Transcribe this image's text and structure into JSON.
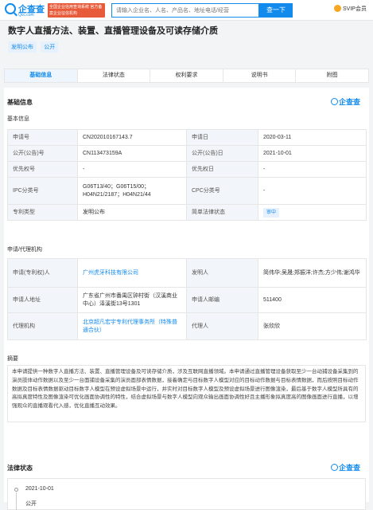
{
  "header": {
    "logo_text": "企查查",
    "logo_sub": "Qcc.com",
    "notice": "全国企业信用查询系统 官方备案企业征信机构",
    "search_placeholder": "请输入企业名、人名、产品名、地址电话/经营",
    "search_button": "查一下",
    "vip_label": "SVIP会员"
  },
  "patent": {
    "title": "数字人直播方法、装置、直播管理设备及可读存储介质",
    "tags": [
      "发明公布",
      "公开"
    ]
  },
  "tabs": [
    {
      "label": "基础信息",
      "active": true
    },
    {
      "label": "法律状态",
      "active": false
    },
    {
      "label": "权利要求",
      "active": false
    },
    {
      "label": "说明书",
      "active": false
    },
    {
      "label": "附图",
      "active": false
    }
  ],
  "basic": {
    "section_title": "基础信息",
    "brand": "企查查",
    "sub_title": "基本信息",
    "rows": [
      {
        "k1": "申请号",
        "v1": "CN202010167143.7",
        "k2": "申请日",
        "v2": "2020-03-11"
      },
      {
        "k1": "公开(公告)号",
        "v1": "CN113473159A",
        "k2": "公开(公告)日",
        "v2": "2021-10-01"
      },
      {
        "k1": "优先权号",
        "v1": "-",
        "k2": "优先权日",
        "v2": "-"
      },
      {
        "k1": "IPC分类号",
        "v1": "G06T13/40；G06T15/00；H04N21/2187；H04N21/44",
        "k2": "CPC分类号",
        "v2": "-"
      },
      {
        "k1": "专利类型",
        "v1": "发明公布",
        "k2": "简单法律状态",
        "v2": "审中"
      }
    ]
  },
  "applicant": {
    "sub_title": "申请/代理机构",
    "rows": [
      {
        "k1": "申请(专利权)人",
        "v1": "广州虎牙科技有限公司",
        "k2": "发明人",
        "v2": "简伟华;吴晟;郑振洋;许杰;方少伟;谢鸿华"
      },
      {
        "k1": "申请人地址",
        "v1": "广东省广州市番禺区钟村街（汉溪商业中心）泽溪街13号1301",
        "k2": "申请人邮编",
        "v2": "511400"
      },
      {
        "k1": "代理机构",
        "v1": "北京超凡宏宇专利代理事务所（特殊普通合伙）",
        "k2": "代理人",
        "v2": "张欣欣"
      }
    ]
  },
  "abstract": {
    "title": "摘要",
    "text": "本申请提供一种数字人直播方法、装置、直播管理设备及可读存储介质，涉及互联网直播领域。本申请通过直播管理设备获取至少一台动捕设备采集到的演员肢体动作数据以及至少一台面捕设备采集的演员面部表情数据，接着确定与目标数字人模型对应的目标动作数据与目标表情数据，而后按照目标动作数据及目标表情数据驱动目标数字人模型在预设虚拟场景中运行，并实时对目标数字人模型及预设虚拟场景进行图像渲染，最后基于数字人模型所具有的高拟真度特性及图像渲染可优化画面协调性的特性，结合虚拟场景与数字人模型向观众输出画面协调性好且主播形象拟真度高的图像画面进行直播，以增强观众的直播观看代入感，优化直播互动效果。"
  },
  "legal": {
    "title": "法律状态",
    "brand": "企查查",
    "events": [
      {
        "date": "2021-10-01",
        "desc": "公开"
      }
    ]
  }
}
